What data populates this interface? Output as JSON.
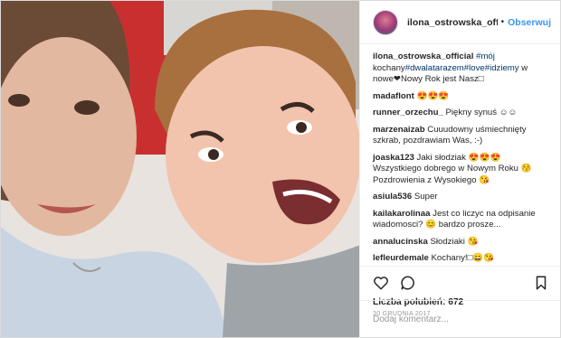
{
  "post": {
    "username": "ilona_ostrowska_offici",
    "separator": "•",
    "follow_label": "Obserwuj"
  },
  "comments": [
    {
      "user": "ilona_ostrowska_official",
      "parts": [
        " ",
        "#mój",
        " kochany",
        "#dwalatarazem",
        "#love",
        "#idziemy",
        " w nowe❤Nowy Rok jest Nasz□"
      ]
    },
    {
      "user": "madaflont",
      "text": "😍😍😍"
    },
    {
      "user": "runner_orzechu_",
      "text": "Piękny synuś ☺☺"
    },
    {
      "user": "marzenaizab",
      "text": "Cuuudowny uśmiechnięty szkrab, pozdrawiam Was, :-)"
    },
    {
      "user": "joaska123",
      "text": "Jaki słodziak 😍😍😍 Wszystkiego dobrego w Nowym Roku 😚 Pozdrowienia z Wysokiego 😘"
    },
    {
      "user": "asiula536",
      "text": "Super"
    },
    {
      "user": "kailakarolinaa",
      "text": "Jest co liczyc na odpisanie wiadomosci? 😊 bardzo prosze..."
    },
    {
      "user": "annalucinska",
      "text": "Słodziaki 😘"
    },
    {
      "user": "lefleurdemale",
      "text": "Kochany!□😄😘"
    }
  ],
  "actions": {
    "likes_label": "Liczba polubień: 672",
    "date": "30 GRUDNIA 2017"
  },
  "add_comment": {
    "placeholder": "Dodaj komentarz..."
  },
  "icons": [
    "heart-icon",
    "comment-icon",
    "bookmark-icon"
  ],
  "colors": {
    "link": "#3897f0",
    "hashtag": "#003569",
    "muted": "#999999"
  }
}
